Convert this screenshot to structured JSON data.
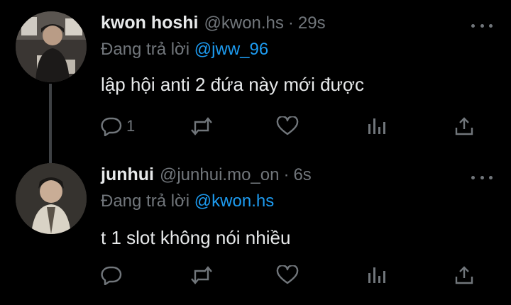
{
  "tweets": [
    {
      "name": "kwon hoshi",
      "handle": "@kwon.hs",
      "time": "29s",
      "reply_prefix": "Đang trả lời",
      "reply_to": "@jww_96",
      "text": "lập hội anti 2 đứa này mới được",
      "reply_count": "1",
      "avatar_icon": "user-photo-icon"
    },
    {
      "name": "junhui",
      "handle": "@junhui.mo_on",
      "time": "6s",
      "reply_prefix": "Đang trả lời",
      "reply_to": "@kwon.hs",
      "text": "t 1 slot không nói nhiều",
      "reply_count": "",
      "avatar_icon": "user-photo-icon"
    }
  ],
  "separator": "·",
  "colors": {
    "background": "#000000",
    "text": "#e7e9ea",
    "muted": "#71767b",
    "link": "#1d9bf0",
    "thread_line": "#3e4144"
  },
  "icons": [
    "reply-icon",
    "retweet-icon",
    "like-icon",
    "views-icon",
    "share-icon",
    "more-icon"
  ]
}
